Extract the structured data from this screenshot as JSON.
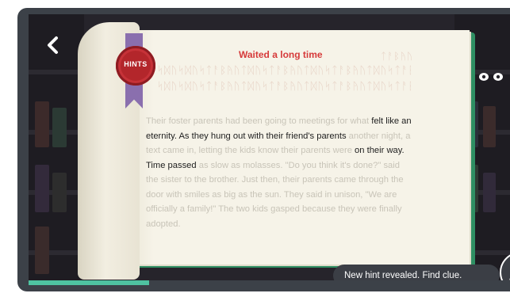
{
  "header": {
    "title": "Waited a long time"
  },
  "hints_button": {
    "label": "HINTS"
  },
  "runes": {
    "row1_right": "ᛏᚨᛒᚤᚢ",
    "row2": "ᛋᛞᚢᛋᛞᚢᛋᛏᚨᛒᚤᚢᛏᛞᚢᛋᛏᚨᛒᚤᚢᛏᛞᚢᛋᛏᚨᛒᚤᚢᛏᛞᚢᛋᛏᚨᛒᚤᚢᛏᛞᚢᛋᛏᚨᛒᚤᚢ",
    "row3": "ᛋᛞᚢᛋᛞᚢᛋᛏᚨᛒᚤᚢᛏᛞᚢᛋᛏᚨᛒᚤᚢᛏᛞᚢᛋᛏᚨᛒᚤᚢᛏᛞᚢᛋᛏᚨᛒᚤᚢᛏᛞᚢᛋᛏᚨᛒᚤᚢ"
  },
  "story": {
    "s1": "Their foster parents had been going to meetings for what",
    "s2": "felt like an eternity. As they hung out with their friend's",
    "s3": "parents",
    "s4": " another night, a text came in, letting the kids know their parents were ",
    "s5": "on their way. Time passed",
    "s6": " as slow as molasses. \"Do you think it's done?\" said the sister to the brother. Just then, their parents came through the door with smiles as big as the sun. They said in unison, \"We are officially a family!\" The two kids gasped because they were finally adopted."
  },
  "toast": {
    "text": "New hint revealed. Find clue."
  },
  "progress": {
    "fraction": 0.25
  },
  "colors": {
    "title": "#d63a3a",
    "book_cover": "#2f8f63",
    "seal": "#b3262b",
    "ribbon": "#8a6fae",
    "progress": "#4fc3a1"
  },
  "icons": {
    "back": "chevron-left-icon",
    "eyes": "eyes-icon",
    "magnifier": "magnifier-icon"
  }
}
